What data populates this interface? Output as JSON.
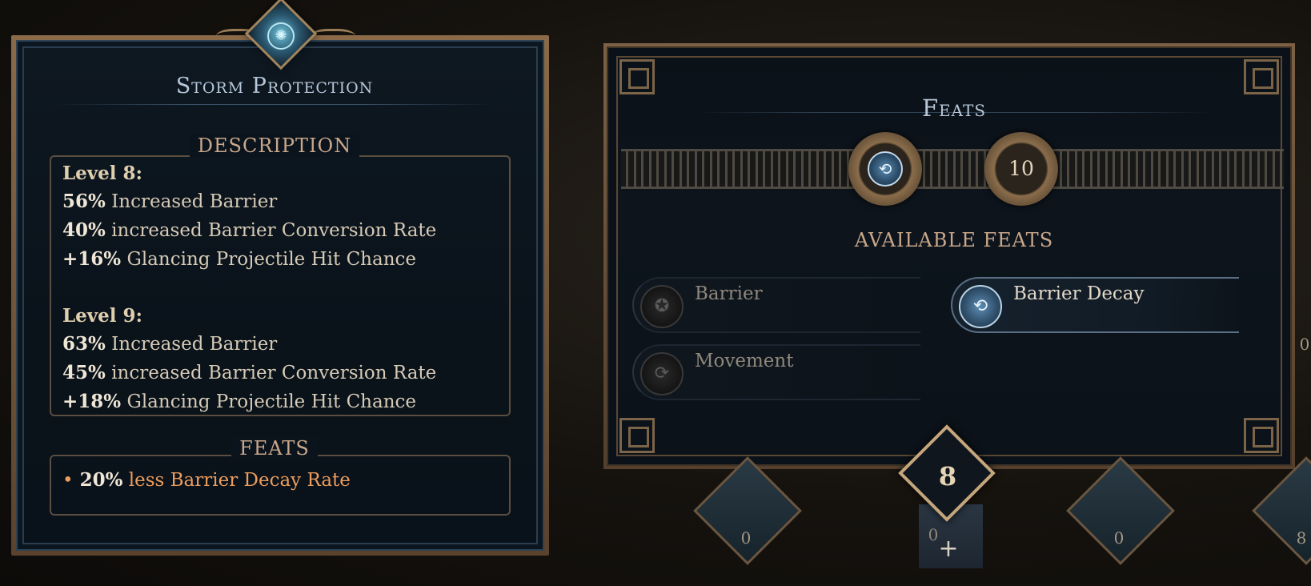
{
  "tooltip": {
    "title": "Storm Protection",
    "description_label": "DESCRIPTION",
    "feats_label": "FEATS",
    "levels": [
      {
        "heading": "Level 8:",
        "lines": [
          {
            "value": "56%",
            "text": " Increased Barrier"
          },
          {
            "value": "40%",
            "text": " increased Barrier Conversion Rate"
          },
          {
            "value": "+16%",
            "text": " Glancing Projectile Hit Chance"
          }
        ]
      },
      {
        "heading": "Level 9:",
        "lines": [
          {
            "value": "63%",
            "text": " Increased Barrier"
          },
          {
            "value": "45%",
            "text": " increased Barrier Conversion Rate"
          },
          {
            "value": "+18%",
            "text": " Glancing Projectile Hit Chance"
          }
        ]
      }
    ],
    "feat": {
      "bullet": "•",
      "value": "20%",
      "text": " less Barrier Decay Rate"
    }
  },
  "feats_panel": {
    "title": "Feats",
    "points_total": "10",
    "available_label": "AVAILABLE FEATS",
    "items": [
      {
        "name": "Barrier",
        "icon": "barrier-icon",
        "active": false
      },
      {
        "name": "Barrier Decay",
        "icon": "barrier-decay-icon",
        "active": true
      },
      {
        "name": "Movement",
        "icon": "movement-icon",
        "active": false
      }
    ]
  },
  "skill_bar": {
    "active_level": "8",
    "active_points": "0",
    "plus_label": "+",
    "slot_counts": [
      "0",
      "0",
      "0",
      "8"
    ],
    "right_edge_count": "0"
  },
  "colors": {
    "accent_orange": "#ec9d5d",
    "title_blue": "#b5c7d9",
    "section_tan": "#c9a78a",
    "frame_bronze": "#8a6a48"
  }
}
